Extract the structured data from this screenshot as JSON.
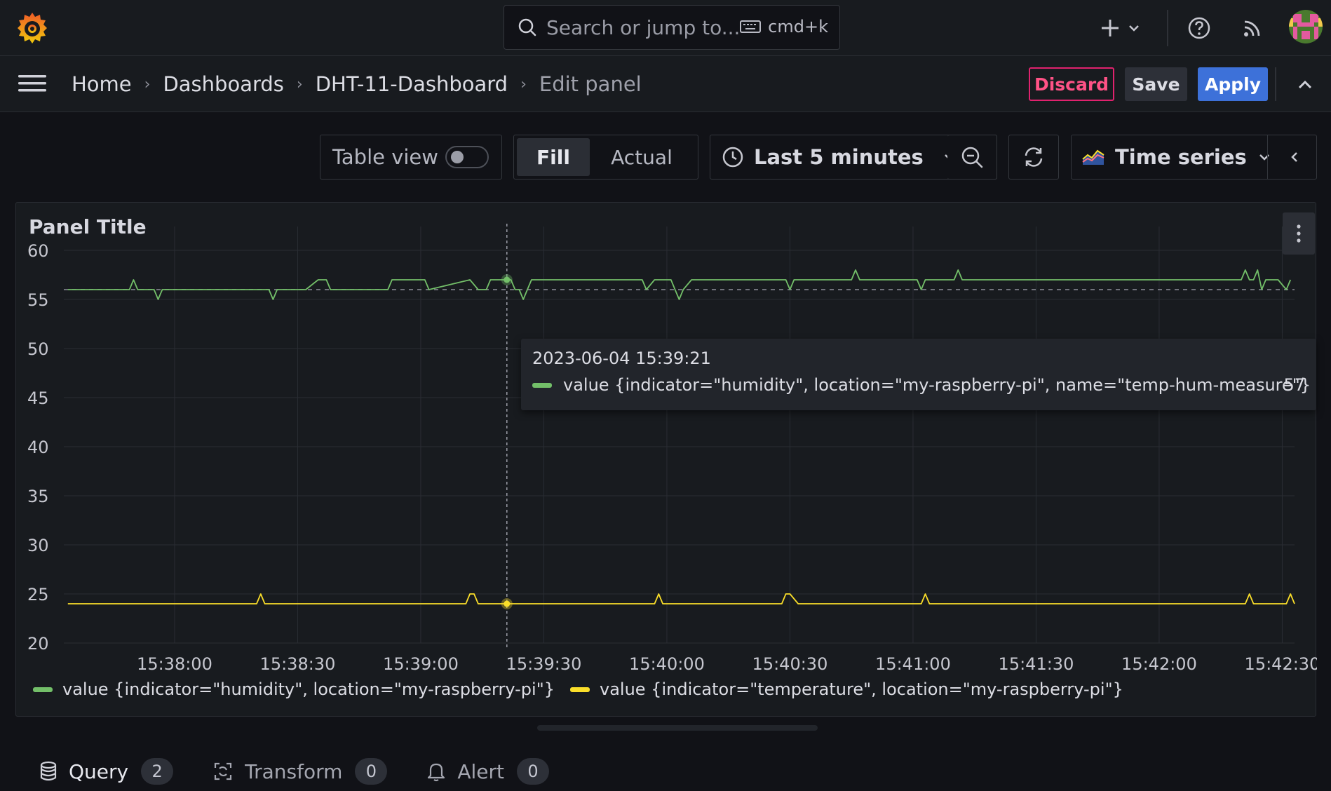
{
  "topbar": {
    "search_placeholder": "Search or jump to...",
    "shortcut": "cmd+k"
  },
  "breadcrumb": [
    {
      "label": "Home"
    },
    {
      "label": "Dashboards"
    },
    {
      "label": "DHT-11-Dashboard"
    },
    {
      "label": "Edit panel"
    }
  ],
  "actions": {
    "discard": "Discard",
    "save": "Save",
    "apply": "Apply"
  },
  "toolbar": {
    "table_view": "Table view",
    "table_view_on": false,
    "fill": "Fill",
    "actual": "Actual",
    "time_range": "Last 5 minutes",
    "visualization": "Time series"
  },
  "panel": {
    "title": "Panel Title",
    "tooltip": {
      "time": "2023-06-04 15:39:21",
      "series": "value {indicator=\"humidity\", location=\"my-raspberry-pi\", name=\"temp-hum-measure\"}",
      "value": "57"
    },
    "legend": [
      {
        "name": "value {indicator=\"humidity\", location=\"my-raspberry-pi\"}",
        "color": "#73bf69"
      },
      {
        "name": "value {indicator=\"temperature\", location=\"my-raspberry-pi\"}",
        "color": "#fade2a"
      }
    ]
  },
  "chart_data": {
    "type": "line",
    "y_ticks": [
      "60",
      "55",
      "50",
      "45",
      "40",
      "35",
      "30",
      "25",
      "20"
    ],
    "ylim": [
      20,
      62
    ],
    "x_ticks": [
      "15:38:00",
      "15:38:30",
      "15:39:00",
      "15:39:30",
      "15:40:00",
      "15:40:30",
      "15:41:00",
      "15:41:30",
      "15:42:00",
      "15:42:30"
    ],
    "x_tick_seconds": [
      0,
      30,
      60,
      90,
      120,
      150,
      180,
      210,
      240,
      270
    ],
    "xlim_seconds": [
      -27,
      273
    ],
    "threshold_value": 56,
    "cursor_time_seconds": 81,
    "series": [
      {
        "name": "value {indicator=\"humidity\", location=\"my-raspberry-pi\"}",
        "color": "#73bf69",
        "x": [
          -26,
          -12,
          -11,
          -10,
          -9,
          -6,
          -5,
          -4,
          -3,
          -2,
          9,
          15,
          22,
          23,
          24,
          25,
          26,
          27,
          32,
          35,
          37,
          38,
          44,
          52,
          53,
          54,
          55,
          61,
          62,
          72,
          74,
          76,
          77,
          80,
          81,
          82,
          83,
          84,
          85,
          86,
          87,
          113,
          114,
          115,
          117,
          121,
          122,
          123,
          124,
          126,
          127,
          128,
          129,
          149,
          150,
          151,
          153,
          154,
          165,
          166,
          167,
          168,
          181,
          182,
          183,
          184,
          190,
          191,
          192,
          193,
          214,
          223,
          260,
          261,
          262,
          263,
          264,
          265,
          266,
          267,
          268,
          269,
          271,
          272
        ],
        "y": [
          56,
          56,
          56,
          57,
          56,
          56,
          56,
          55,
          56,
          56,
          56,
          56,
          56,
          56,
          55,
          56,
          56,
          56,
          56,
          57,
          57,
          56,
          56,
          56,
          57,
          57,
          57,
          57,
          56,
          57,
          56,
          56,
          57,
          57,
          57,
          57,
          56,
          56,
          55,
          56,
          57,
          57,
          57,
          56,
          57,
          57,
          56,
          55,
          56,
          57,
          57,
          57,
          57,
          57,
          56,
          57,
          57,
          57,
          57,
          58,
          57,
          57,
          57,
          56,
          57,
          57,
          57,
          58,
          57,
          57,
          57,
          57,
          57,
          58,
          57,
          57,
          58,
          56,
          57,
          57,
          57,
          57,
          56,
          57
        ]
      },
      {
        "name": "value {indicator=\"temperature\", location=\"my-raspberry-pi\"}",
        "color": "#fade2a",
        "x": [
          -26,
          20,
          21,
          22,
          70,
          71,
          72,
          73,
          74,
          117,
          118,
          119,
          148,
          149,
          150,
          152,
          153,
          182,
          183,
          184,
          261,
          262,
          263,
          271,
          272,
          273
        ],
        "y": [
          24,
          24,
          25,
          24,
          24,
          24,
          25,
          25,
          24,
          24,
          25,
          24,
          24,
          25,
          25,
          24,
          24,
          24,
          25,
          24,
          24,
          25,
          24,
          24,
          25,
          24
        ]
      }
    ]
  },
  "tabs": [
    {
      "label": "Query",
      "count": "2"
    },
    {
      "label": "Transform",
      "count": "0"
    },
    {
      "label": "Alert",
      "count": "0"
    }
  ]
}
